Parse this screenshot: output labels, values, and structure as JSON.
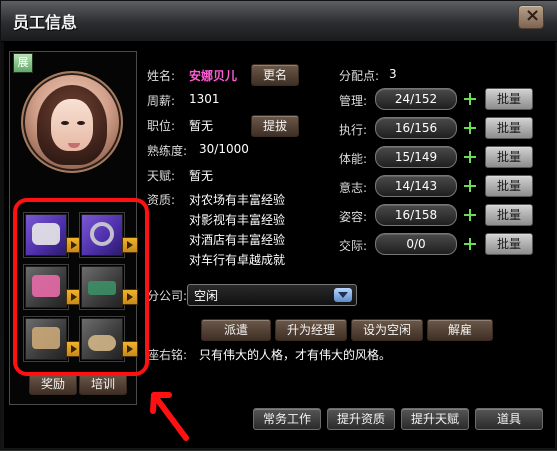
{
  "window": {
    "title": "员工信息",
    "close_icon": "close-icon"
  },
  "left": {
    "expand_tab": "展",
    "tabs": {
      "reward": "奖励",
      "train": "培训"
    }
  },
  "profile": {
    "name_label": "姓名:",
    "name_value": "安娜贝儿",
    "rename_button": "更名",
    "salary_label": "周薪:",
    "salary_value": "1301",
    "position_label": "职位:",
    "position_value": "暂无",
    "promote_button": "提拔",
    "proficiency_label": "熟练度:",
    "proficiency_value": "30/1000",
    "talent_label": "天赋:",
    "talent_value": "暂无",
    "qualification_label": "资质:",
    "qualifications": [
      "对农场有丰富经验",
      "对影视有丰富经验",
      "对酒店有丰富经验",
      "对车行有卓越成就"
    ],
    "company_label": "分公司:",
    "company_value": "空闲",
    "motto_label": "座右铭:",
    "motto_value": "只有伟大的人格，才有伟大的风格。"
  },
  "stats": {
    "points_label": "分配点:",
    "points_value": "3",
    "rows": [
      {
        "label": "管理:",
        "value": "24/152",
        "batch": "批量"
      },
      {
        "label": "执行:",
        "value": "16/156",
        "batch": "批量"
      },
      {
        "label": "体能:",
        "value": "15/149",
        "batch": "批量"
      },
      {
        "label": "意志:",
        "value": "14/143",
        "batch": "批量"
      },
      {
        "label": "姿容:",
        "value": "16/158",
        "batch": "批量"
      },
      {
        "label": "交际:",
        "value": "0/0",
        "batch": "批量"
      }
    ]
  },
  "actions": {
    "assign": "派遣",
    "manager": "升为经理",
    "idle": "设为空闲",
    "dismiss": "解雇",
    "routine": "常务工作",
    "improve_quality": "提升资质",
    "improve_talent": "提升天赋",
    "items": "道具"
  },
  "equipment": {
    "slots": [
      {
        "name": "hat-item-icon"
      },
      {
        "name": "ring-item-icon"
      },
      {
        "name": "shirt-item-icon"
      },
      {
        "name": "belt-item-icon"
      },
      {
        "name": "pants-item-icon"
      },
      {
        "name": "shoes-item-icon"
      }
    ]
  }
}
